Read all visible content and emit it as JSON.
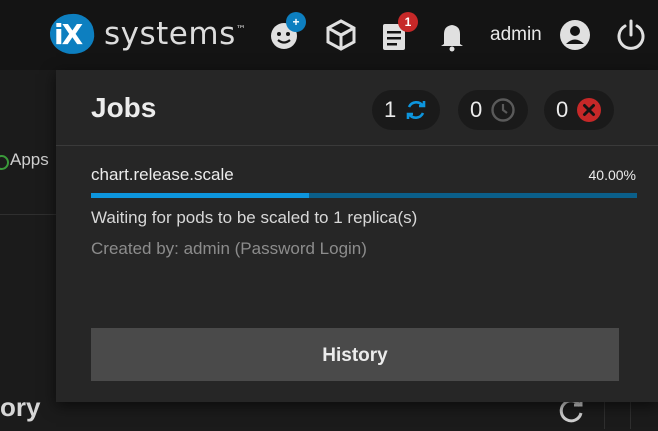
{
  "header": {
    "logo_mark": "iX",
    "logo_word": "systems",
    "logo_tm": "™",
    "feedback_badge": "+",
    "tasks_badge": "1",
    "username": "admin",
    "icons": [
      "feedback-icon",
      "truecommand-icon",
      "jobs-icon",
      "bell-icon",
      "account-icon",
      "power-icon"
    ]
  },
  "background": {
    "nav_item": "Apps",
    "section_title": "ory"
  },
  "jobs_panel": {
    "title": "Jobs",
    "counts": {
      "running": "1",
      "waiting": "0",
      "failed": "0"
    },
    "job": {
      "name": "chart.release.scale",
      "percent_text": "40.00%",
      "progress": 0.4,
      "description": "Waiting for pods to be scaled to 1 replica(s)",
      "created_by": "Created by: admin (Password Login)"
    },
    "history_label": "History"
  },
  "colors": {
    "accent": "#0d95dd",
    "danger": "#c62828",
    "panel_bg": "#262626"
  }
}
